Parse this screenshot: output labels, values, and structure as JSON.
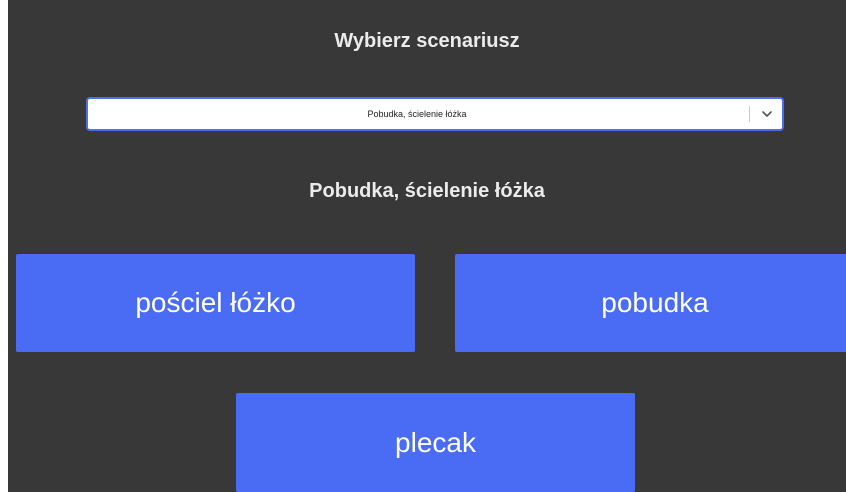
{
  "header": {
    "title": "Wybierz scenariusz"
  },
  "scenario_select": {
    "selected": "Pobudka, ścielenie łóżka",
    "arrow_icon": "chevron-down-icon"
  },
  "scenario": {
    "title": "Pobudka, ścielenie łóżka",
    "buttons": [
      {
        "label": "pościel łóżko"
      },
      {
        "label": "pobudka"
      },
      {
        "label": "plecak"
      }
    ]
  },
  "colors": {
    "background": "#383838",
    "button": "#4a6cf5",
    "select_border": "#4a6ff0",
    "heading_text": "#ebebeb"
  }
}
